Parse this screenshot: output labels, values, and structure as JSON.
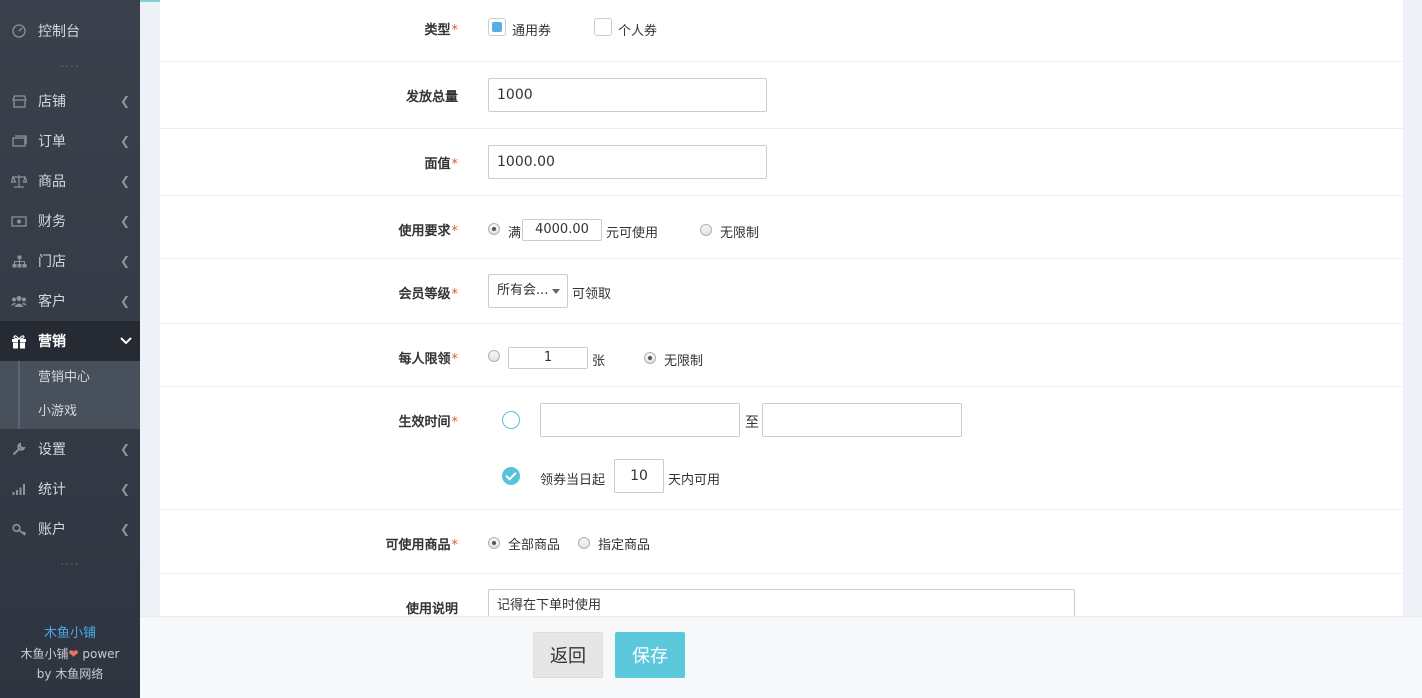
{
  "sidebar": {
    "items": [
      {
        "label": "控制台",
        "icon": "dashboard-icon"
      },
      {
        "label": "店铺",
        "icon": "store-icon"
      },
      {
        "label": "订单",
        "icon": "order-icon"
      },
      {
        "label": "商品",
        "icon": "balance-icon"
      },
      {
        "label": "财务",
        "icon": "money-icon"
      },
      {
        "label": "门店",
        "icon": "sitemap-icon"
      },
      {
        "label": "客户",
        "icon": "users-icon"
      },
      {
        "label": "营销",
        "icon": "gift-icon"
      },
      {
        "label": "设置",
        "icon": "wrench-icon"
      },
      {
        "label": "统计",
        "icon": "bar-chart-icon"
      },
      {
        "label": "账户",
        "icon": "key-icon"
      }
    ],
    "dots": "....",
    "submenu": [
      "营销中心",
      "小游戏"
    ],
    "footer": {
      "brand": "木鱼小铺",
      "line1_pre": "木鱼小铺",
      "line1_post": " power",
      "line2_pre": "by ",
      "line2_name": "木鱼网络"
    }
  },
  "form": {
    "type": {
      "label": "类型",
      "req": "*",
      "opt1": "通用券",
      "opt2": "个人券"
    },
    "total": {
      "label": "发放总量",
      "value": "1000"
    },
    "face": {
      "label": "面值",
      "req": "*",
      "value": "1000.00"
    },
    "usage": {
      "label": "使用要求",
      "req": "*",
      "pre": "满",
      "amount": "4000.00",
      "post": "元可使用",
      "unlimited": "无限制"
    },
    "level": {
      "label": "会员等级",
      "req": "*",
      "selected": "所有会...",
      "post": "可领取"
    },
    "limit": {
      "label": "每人限领",
      "req": "*",
      "count": "1",
      "unit": "张",
      "unlimited": "无限制"
    },
    "time": {
      "label": "生效时间",
      "req": "*",
      "to": "至",
      "rel_pre": "领券当日起",
      "days": "10",
      "rel_post": "天内可用"
    },
    "goods": {
      "label": "可使用商品",
      "req": "*",
      "all": "全部商品",
      "specific": "指定商品"
    },
    "desc": {
      "label": "使用说明",
      "value": "记得在下单时使用"
    }
  },
  "buttons": {
    "back": "返回",
    "save": "保存"
  }
}
